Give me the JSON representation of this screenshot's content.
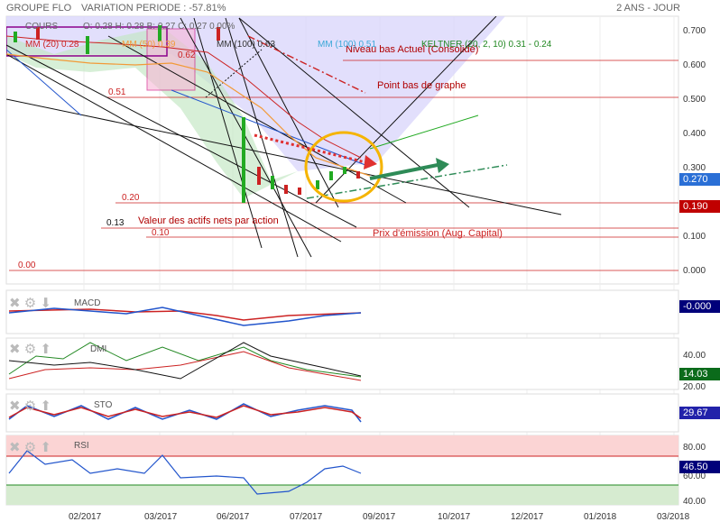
{
  "header": {
    "symbol": "GROUPE FLO",
    "variation": "VARIATION PERIODE : -57.81%",
    "timeframe": "2 ANS - JOUR"
  },
  "legend": {
    "cours": "COURS",
    "ohlc": "O: 0.28   H: 0.28   B: 0.27   C: 0.27  0.00%",
    "mm20": "MM (20)  0.28",
    "mm50": "MM (50)  0.39",
    "mm100": "MM (100)  0.63",
    "mm100b": "MM (100)  0.51",
    "keltner": "KELTNER (20, 2, 10)  0.31 - 0.24"
  },
  "annotations": {
    "niveau_bas": "Niveau bas Actuel (Consolidé)",
    "point_bas": "Point bas de graphe",
    "valeur_actifs": "Valeur des actifs nets par action",
    "prix_emission": "Prix d'émission (Aug. Capital)",
    "l062": "0.62",
    "l051": "0.51",
    "l020": "0.20",
    "l013": "0.13",
    "l010": "0.10",
    "l000": "0.00"
  },
  "price_axis": [
    "0.700",
    "0.600",
    "0.500",
    "0.400",
    "0.300",
    "0.200",
    "0.100",
    "0.000"
  ],
  "badges": {
    "last": "0.270",
    "support": "0.190",
    "macd": "-0.000",
    "dmi": "14.03",
    "sto": "29.67",
    "rsi": "46.50"
  },
  "panels": {
    "macd": "MACD",
    "dmi": "DMI",
    "sto": "STO",
    "rsi": "RSI",
    "dmi_axis": [
      "40.00",
      "20.00"
    ],
    "rsi_axis": [
      "80.00",
      "60.00",
      "40.00"
    ]
  },
  "time_axis": [
    "02/2017",
    "03/2017",
    "06/2017",
    "07/2017",
    "09/2017",
    "10/2017",
    "12/2017",
    "01/2018",
    "03/2018"
  ],
  "colors": {
    "up": "#22aa22",
    "down": "#cc2222",
    "accent_blue": "#2255cc",
    "support_red": "#cc0000",
    "ellipse": "#f5b400",
    "arrow_green": "#2e8b57"
  },
  "chart_data": {
    "type": "candlestick",
    "ylim": [
      0,
      0.75
    ],
    "horizontal_levels": [
      0.62,
      0.51,
      0.2,
      0.13,
      0.1,
      0.0
    ],
    "close_series": [
      {
        "date": "2017-01",
        "value": 0.68
      },
      {
        "date": "2017-02",
        "value": 0.72
      },
      {
        "date": "2017-03",
        "value": 0.7
      },
      {
        "date": "2017-04",
        "value": 0.72
      },
      {
        "date": "2017-05",
        "value": 0.68
      },
      {
        "date": "2017-06",
        "value": 0.21
      },
      {
        "date": "2017-06b",
        "value": 0.25
      },
      {
        "date": "2017-07",
        "value": 0.23
      },
      {
        "date": "2017-07b",
        "value": 0.27
      },
      {
        "date": "2017-08",
        "value": 0.29
      },
      {
        "date": "2017-08b",
        "value": 0.27
      }
    ],
    "last": 0.27
  }
}
